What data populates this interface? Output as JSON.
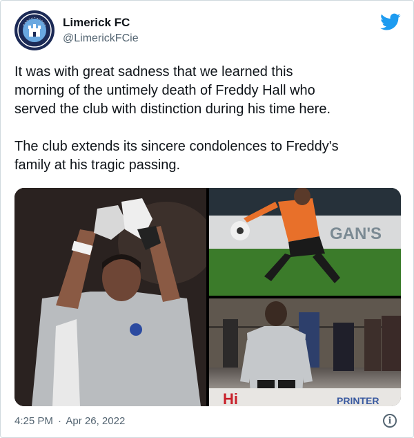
{
  "tweet": {
    "author_name": "Limerick FC",
    "author_handle": "@LimerickFCie",
    "avatar_icon": "limerick-fc-crest-icon",
    "platform_icon": "twitter-bird-icon",
    "paragraphs": [
      [
        "It was with great sadness that we learned this",
        "morning of the untimely death of Freddy Hall who",
        "served the club with distinction during his time here."
      ],
      [
        "The club extends its sincere condolences to Freddy's",
        "family at his tragic passing."
      ]
    ],
    "time": "4:25 PM",
    "separator": "·",
    "date": "Apr 26, 2022",
    "info_icon": "info-icon"
  },
  "media": {
    "photos": [
      {
        "name": "photo-goalkeeper-applauding"
      },
      {
        "name": "photo-goalkeeper-kicking-ball",
        "banner_text": "GAN'S"
      },
      {
        "name": "photo-goalkeeper-smiling",
        "banner_text": "PRINTER"
      }
    ]
  },
  "colors": {
    "text": "#0f1419",
    "secondary_text": "#536471",
    "twitter_blue": "#1d9bf0",
    "border": "#cfd9de",
    "crest_navy": "#1c2a56"
  }
}
